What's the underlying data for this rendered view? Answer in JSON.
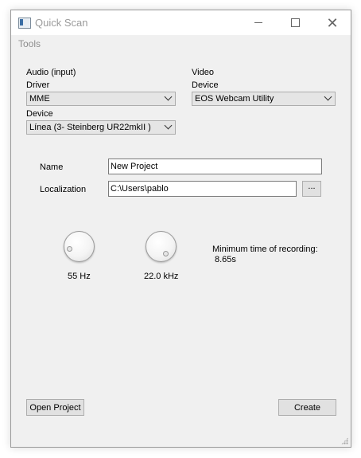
{
  "window": {
    "title": "Quick Scan",
    "icon": "app-window-icon"
  },
  "menu": {
    "tools": "Tools"
  },
  "audio": {
    "section_label": "Audio (input)",
    "driver_label": "Driver",
    "driver_value": "MME",
    "device_label": "Device",
    "device_value": "Línea (3- Steinberg UR22mkII )"
  },
  "video": {
    "section_label": "Video",
    "device_label": "Device",
    "device_value": "EOS Webcam Utility"
  },
  "project": {
    "name_label": "Name",
    "name_value": "New Project",
    "localization_label": "Localization",
    "localization_value": "C:\\Users\\pablo",
    "browse_label": "..."
  },
  "dials": {
    "low_value": "55 Hz",
    "high_value": "22.0 kHz"
  },
  "recording": {
    "min_time_label": "Minimum time of recording:",
    "min_time_value": "8.65s"
  },
  "buttons": {
    "open_project": "Open Project",
    "create": "Create"
  }
}
